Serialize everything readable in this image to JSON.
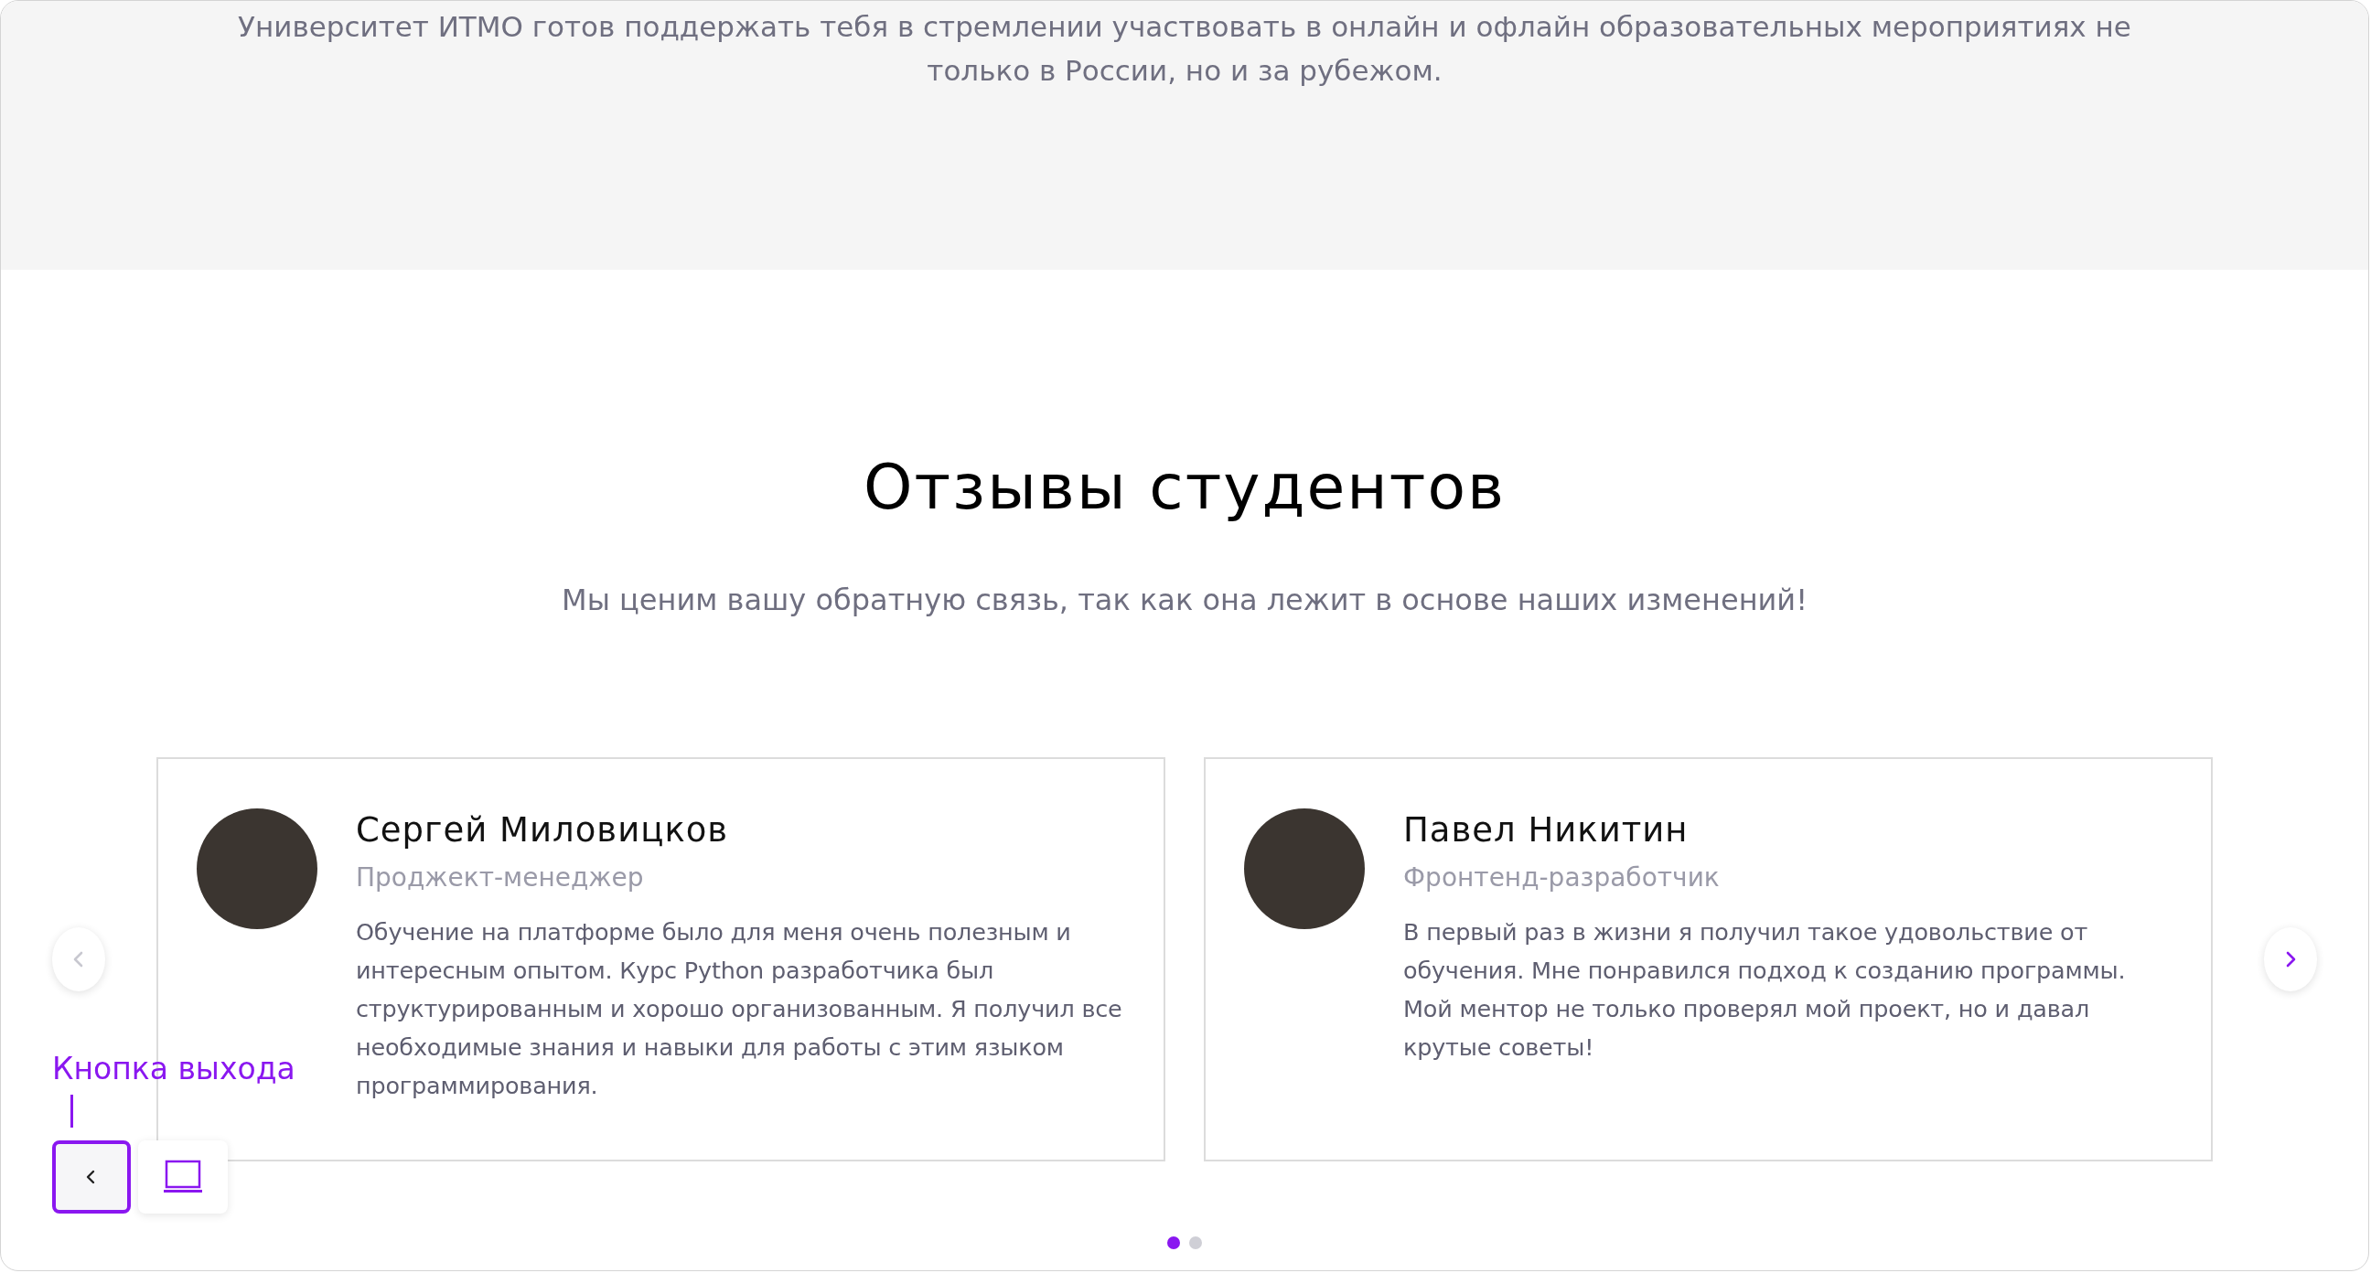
{
  "intro": {
    "text": "Университет ИТМО готов поддержать тебя в стремлении участвовать в онлайн и офлайн образовательных мероприятиях не только в России, но и за рубежом."
  },
  "reviews": {
    "title": "Отзывы студентов",
    "subtitle": "Мы ценим вашу обратную связь, так как она лежит в основе наших изменений!",
    "prev_button": {
      "disabled": true
    },
    "next_button": {
      "disabled": false
    },
    "cards": [
      {
        "name": "Сергей Миловицков",
        "role": "Проджект-менеджер",
        "text": "Обучение на платформе было для меня очень полезным и интересным опытом. Курс Python разработчика был структурированным и хорошо организованным. Я получил все необходимые знания и навыки для работы с этим языком программирования."
      },
      {
        "name": "Павел Никитин",
        "role": "Фронтенд-разработчик",
        "text": "В первый раз в жизни я получил такое удовольствие от обучения. Мне понравился подход к созданию программы. Мой ментор не только проверял мой проект, но и давал крутые советы!"
      }
    ],
    "dots": [
      {
        "selected": true
      },
      {
        "selected": false
      }
    ]
  },
  "annotation": {
    "label": "Кнопка выхода"
  }
}
